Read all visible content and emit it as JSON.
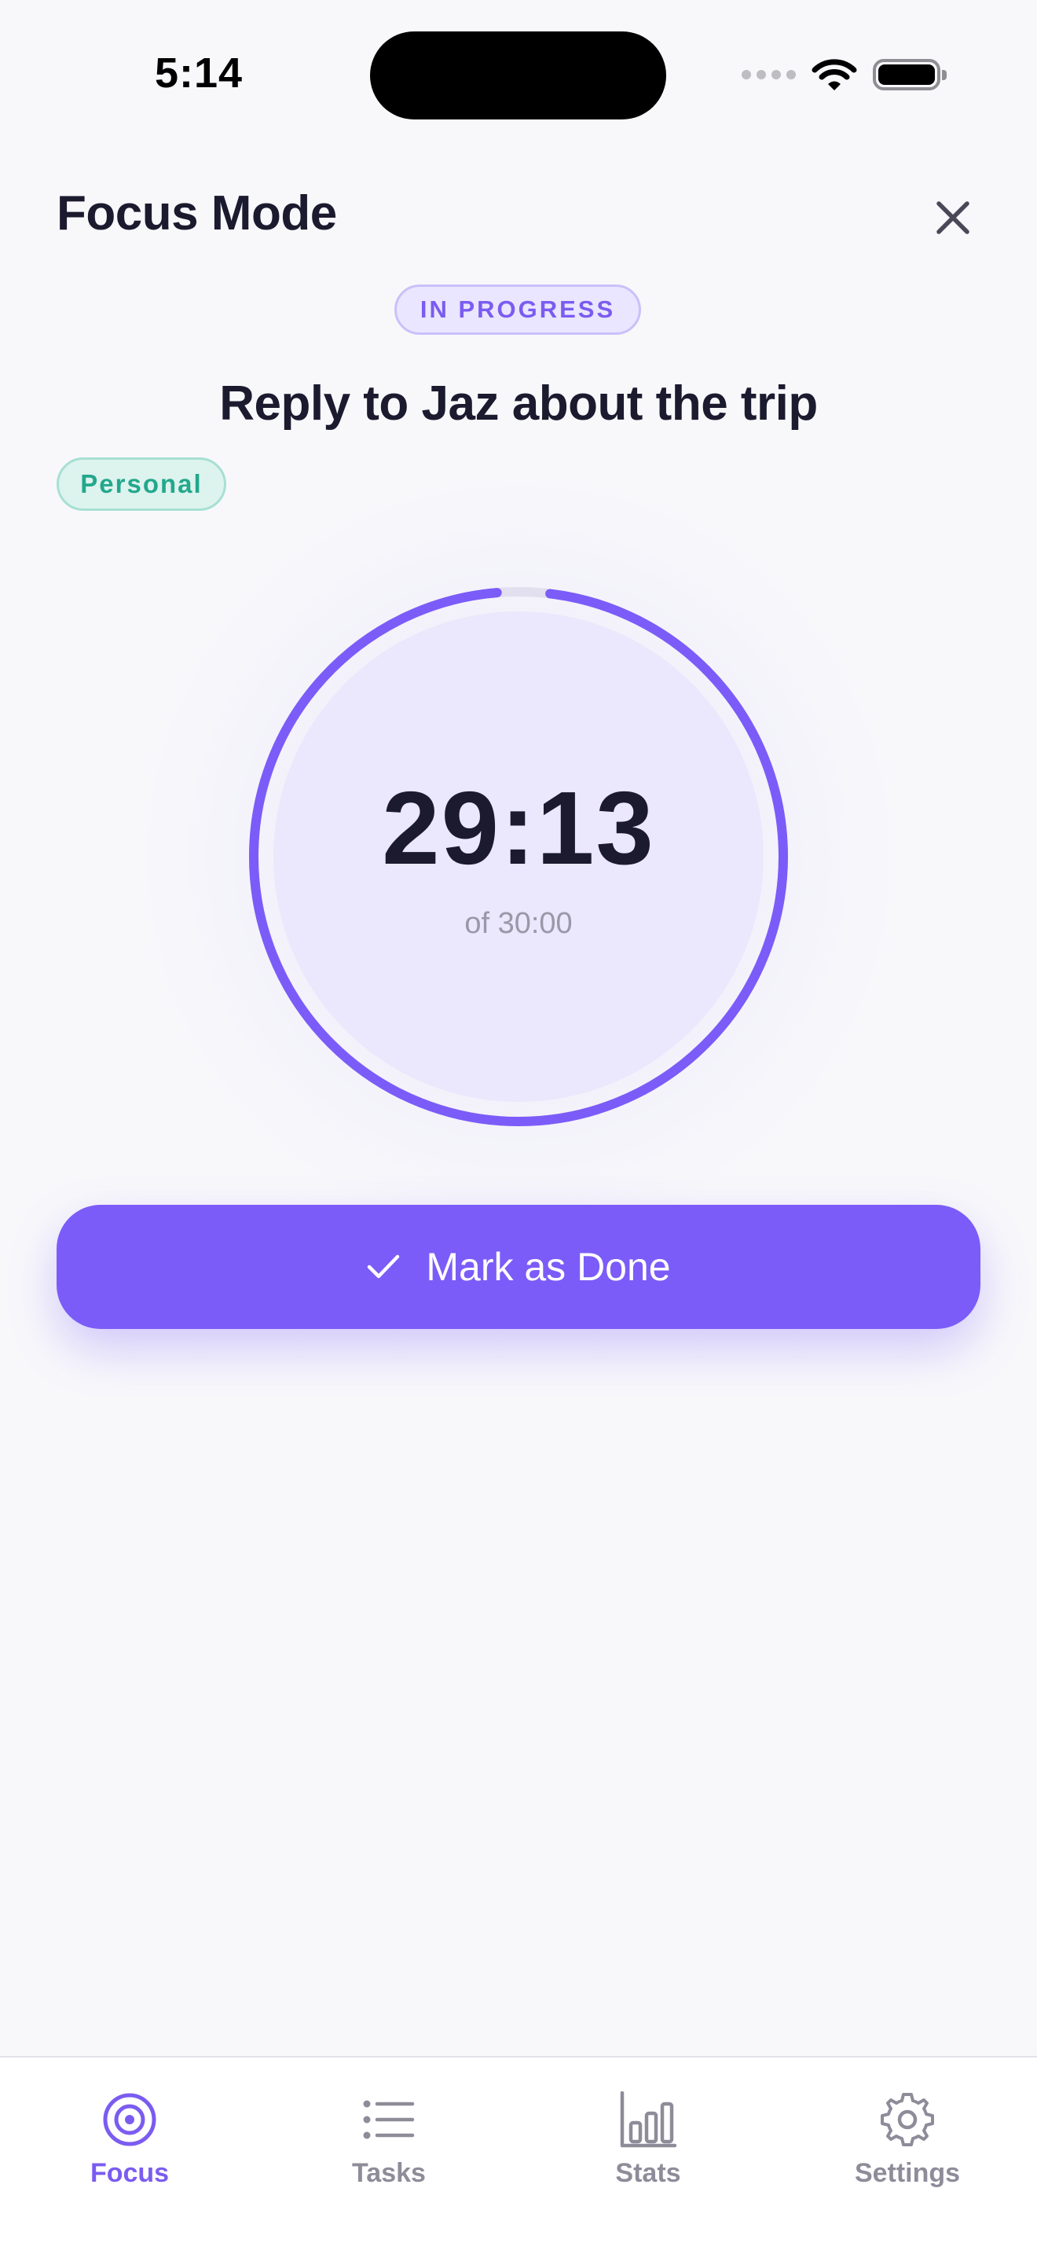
{
  "status_bar": {
    "time": "5:14"
  },
  "header": {
    "title": "Focus Mode",
    "close_icon": "close-icon"
  },
  "task": {
    "status": "IN PROGRESS",
    "title": "Reply to Jaz about the trip",
    "category": "Personal"
  },
  "timer": {
    "remaining": "29:13",
    "total_label": "of 30:00",
    "progress_fraction": 0.974
  },
  "actions": {
    "done_label": "Mark as Done",
    "done_icon": "checkmark-icon"
  },
  "tab_bar": {
    "active": "focus",
    "items": [
      {
        "id": "focus",
        "label": "Focus",
        "icon": "target-icon"
      },
      {
        "id": "tasks",
        "label": "Tasks",
        "icon": "list-icon"
      },
      {
        "id": "stats",
        "label": "Stats",
        "icon": "bar-chart-icon"
      },
      {
        "id": "settings",
        "label": "Settings",
        "icon": "gear-icon"
      }
    ]
  },
  "colors": {
    "accent": "#7B5CF8",
    "category": "#23A88C",
    "text_primary": "#1B1A2E",
    "text_muted": "#8E8C99"
  }
}
